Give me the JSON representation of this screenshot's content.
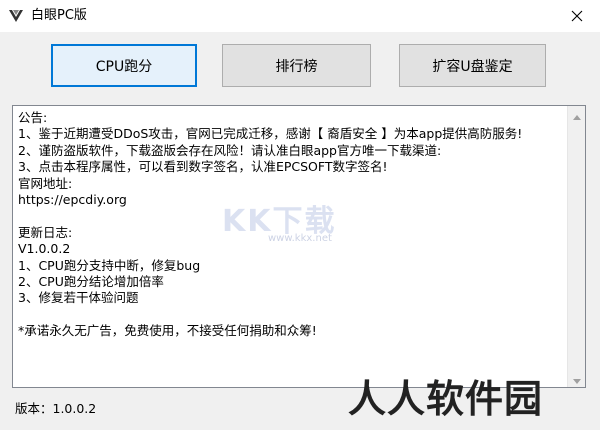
{
  "window": {
    "title": "白眼PC版"
  },
  "toolbar": {
    "buttons": [
      {
        "label": "CPU跑分"
      },
      {
        "label": "排行榜"
      },
      {
        "label": "扩容U盘鉴定"
      }
    ]
  },
  "notice": {
    "lines": [
      "公告:",
      "1、鉴于近期遭受DDoS攻击，官网已完成迁移，感谢【 裔盾安全 】为本app提供高防服务!",
      "2、谨防盗版软件，下载盗版会存在风险！请认准白眼app官方唯一下载渠道:",
      "3、点击本程序属性，可以看到数字签名，认准EPCSOFT数字签名!",
      "官网地址:",
      "https://epcdiy.org",
      "",
      "更新日志:",
      "V1.0.0.2",
      "1、CPU跑分支持中断，修复bug",
      "2、CPU跑分结论增加倍率",
      "3、修复若干体验问题",
      "",
      "*承诺永久无广告，免费使用，不接受任何捐助和众筹!"
    ]
  },
  "status": {
    "version": "版本：1.0.0.2"
  },
  "watermarks": {
    "kk": "KK下载",
    "kk_url": "www.kkx.net",
    "brand": "人人软件园"
  },
  "colors": {
    "focus_border": "#0078d7",
    "button_bg": "#e1e1e1",
    "window_bg": "#f0f0f0"
  }
}
